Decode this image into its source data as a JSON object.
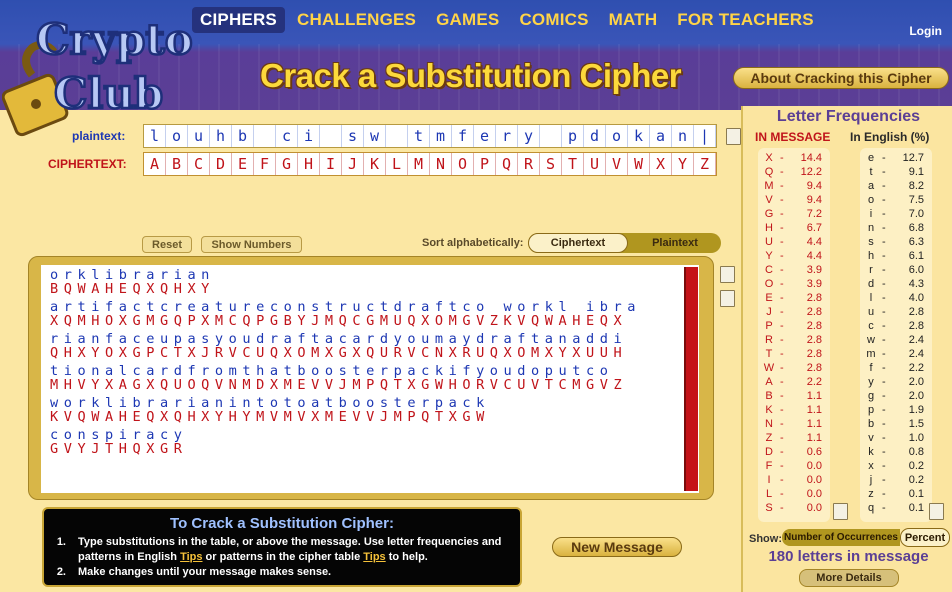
{
  "nav": {
    "items": [
      "CIPHERS",
      "CHALLENGES",
      "GAMES",
      "COMICS",
      "MATH",
      "FOR TEACHERS"
    ],
    "active_index": 0,
    "login": "Login"
  },
  "logo": {
    "line1": "Crypto",
    "line2": "Club"
  },
  "page_title": "Crack a Substitution Cipher",
  "about_button": "About Cracking this Cipher",
  "key": {
    "plaintext_label": "plaintext:",
    "ciphertext_label": "CIPHERTEXT:",
    "plaintext": [
      "l",
      "o",
      "u",
      "h",
      "b",
      "",
      "c",
      "i",
      "",
      "s",
      "w",
      "",
      "t",
      "m",
      "f",
      "e",
      "r",
      "y",
      "",
      "p",
      "d",
      "o",
      "k",
      "a",
      "n",
      "|"
    ],
    "ciphertext": [
      "A",
      "B",
      "C",
      "D",
      "E",
      "F",
      "G",
      "H",
      "I",
      "J",
      "K",
      "L",
      "M",
      "N",
      "O",
      "P",
      "Q",
      "R",
      "S",
      "T",
      "U",
      "V",
      "W",
      "X",
      "Y",
      "Z"
    ]
  },
  "controls": {
    "reset": "Reset",
    "show_numbers": "Show Numbers",
    "sort_label": "Sort alphabetically:",
    "sort_ciphertext": "Ciphertext",
    "sort_plaintext": "Plaintext"
  },
  "message": [
    {
      "plain": "orklibrarian",
      "cipher": "BQWAHEQXQHXY"
    },
    {
      "plain": "artifactcreatureconstructdraftco workl ibra",
      "cipher": "XQMHOXGMGQPXMCQPGBYJMQCGMUQXOMGVZKVQWAHEQX"
    },
    {
      "plain": "rianfaceupasyoudraftacardyoumaydraftanaddi",
      "cipher": "QHXYOXGPCTXJRVCUQXOMXGXQURVCNXRUQXOMXYXUUH"
    },
    {
      "plain": "tionalcardfromthatboosterpackifyoudoputco",
      "cipher": "MHVYXAGXQUOQVNMDXMEVVJMPQTXGWHORVCUVTCMGVZ"
    },
    {
      "plain": "worklibrarianintotoatboosterpack",
      "cipher": "KVQWAHEQXQHXYHYMVMVXMEVVJMPQTXGW"
    },
    {
      "plain": "conspiracy",
      "cipher": "GVYJTHQXGR"
    }
  ],
  "instructions": {
    "title": "To Crack a Substitution Cipher:",
    "step1_num": "1.",
    "step1_a": "Type substitutions in the table, or above the message. Use letter frequencies and patterns in English ",
    "step1_tips1": "Tips",
    "step1_b": " or patterns in the cipher table ",
    "step1_tips2": "Tips",
    "step1_c": " to help.",
    "step2_num": "2.",
    "step2": "Make changes until your message makes sense."
  },
  "new_message": "New Message",
  "frequencies": {
    "title": "Letter Frequencies",
    "in_message_header": "IN MESSAGE",
    "in_english_header": "In English (%)",
    "in_message": [
      {
        "letter": "X",
        "value": "14.4"
      },
      {
        "letter": "Q",
        "value": "12.2"
      },
      {
        "letter": "M",
        "value": "9.4"
      },
      {
        "letter": "V",
        "value": "9.4"
      },
      {
        "letter": "G",
        "value": "7.2"
      },
      {
        "letter": "H",
        "value": "6.7"
      },
      {
        "letter": "U",
        "value": "4.4"
      },
      {
        "letter": "Y",
        "value": "4.4"
      },
      {
        "letter": "C",
        "value": "3.9"
      },
      {
        "letter": "O",
        "value": "3.9"
      },
      {
        "letter": "E",
        "value": "2.8"
      },
      {
        "letter": "J",
        "value": "2.8"
      },
      {
        "letter": "P",
        "value": "2.8"
      },
      {
        "letter": "R",
        "value": "2.8"
      },
      {
        "letter": "T",
        "value": "2.8"
      },
      {
        "letter": "W",
        "value": "2.8"
      },
      {
        "letter": "A",
        "value": "2.2"
      },
      {
        "letter": "B",
        "value": "1.1"
      },
      {
        "letter": "K",
        "value": "1.1"
      },
      {
        "letter": "N",
        "value": "1.1"
      },
      {
        "letter": "Z",
        "value": "1.1"
      },
      {
        "letter": "D",
        "value": "0.6"
      },
      {
        "letter": "F",
        "value": "0.0"
      },
      {
        "letter": "I",
        "value": "0.0"
      },
      {
        "letter": "L",
        "value": "0.0"
      },
      {
        "letter": "S",
        "value": "0.0"
      }
    ],
    "in_english": [
      {
        "letter": "e",
        "value": "12.7"
      },
      {
        "letter": "t",
        "value": "9.1"
      },
      {
        "letter": "a",
        "value": "8.2"
      },
      {
        "letter": "o",
        "value": "7.5"
      },
      {
        "letter": "i",
        "value": "7.0"
      },
      {
        "letter": "n",
        "value": "6.8"
      },
      {
        "letter": "s",
        "value": "6.3"
      },
      {
        "letter": "h",
        "value": "6.1"
      },
      {
        "letter": "r",
        "value": "6.0"
      },
      {
        "letter": "d",
        "value": "4.3"
      },
      {
        "letter": "l",
        "value": "4.0"
      },
      {
        "letter": "u",
        "value": "2.8"
      },
      {
        "letter": "c",
        "value": "2.8"
      },
      {
        "letter": "w",
        "value": "2.4"
      },
      {
        "letter": "m",
        "value": "2.4"
      },
      {
        "letter": "f",
        "value": "2.2"
      },
      {
        "letter": "y",
        "value": "2.0"
      },
      {
        "letter": "g",
        "value": "2.0"
      },
      {
        "letter": "p",
        "value": "1.9"
      },
      {
        "letter": "b",
        "value": "1.5"
      },
      {
        "letter": "v",
        "value": "1.0"
      },
      {
        "letter": "k",
        "value": "0.8"
      },
      {
        "letter": "x",
        "value": "0.2"
      },
      {
        "letter": "j",
        "value": "0.2"
      },
      {
        "letter": "z",
        "value": "0.1"
      },
      {
        "letter": "q",
        "value": "0.1"
      }
    ],
    "show_label": "Show:",
    "show_count": "Number of Occurrences",
    "show_percent": "Percent",
    "letters_count": "180 letters in message",
    "more_details": "More Details"
  }
}
